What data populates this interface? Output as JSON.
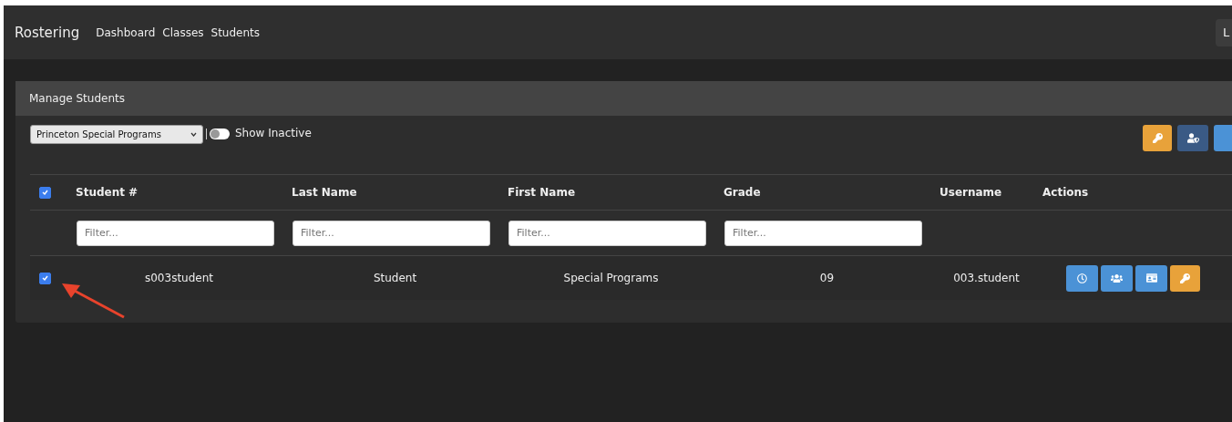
{
  "navbar": {
    "brand": "Rostering",
    "links": [
      "Dashboard",
      "Classes",
      "Students"
    ],
    "right_button": "L"
  },
  "panel": {
    "title": "Manage Students",
    "school_select": {
      "value": "Princeton Special Programs"
    },
    "show_inactive": {
      "label": "Show Inactive",
      "on": false
    },
    "toolbar_buttons": [
      {
        "kind": "key"
      },
      {
        "kind": "user-shield"
      },
      {
        "kind": "blank"
      }
    ],
    "table": {
      "select_all": {
        "checked": true
      },
      "columns": [
        "Student #",
        "Last Name",
        "First Name",
        "Grade",
        "Username",
        "Actions"
      ],
      "filters": [
        {
          "placeholder": "Filter..."
        },
        {
          "placeholder": "Filter..."
        },
        {
          "placeholder": "Filter..."
        },
        {
          "placeholder": "Filter..."
        }
      ],
      "rows": [
        {
          "checked": true,
          "cells": [
            "s003student",
            "Student",
            "Special Programs",
            "09",
            "003.student"
          ],
          "actions": [
            {
              "kind": "clock"
            },
            {
              "kind": "users"
            },
            {
              "kind": "id-card"
            },
            {
              "kind": "key"
            }
          ]
        }
      ]
    }
  },
  "annotation": {
    "kind": "arrow"
  }
}
